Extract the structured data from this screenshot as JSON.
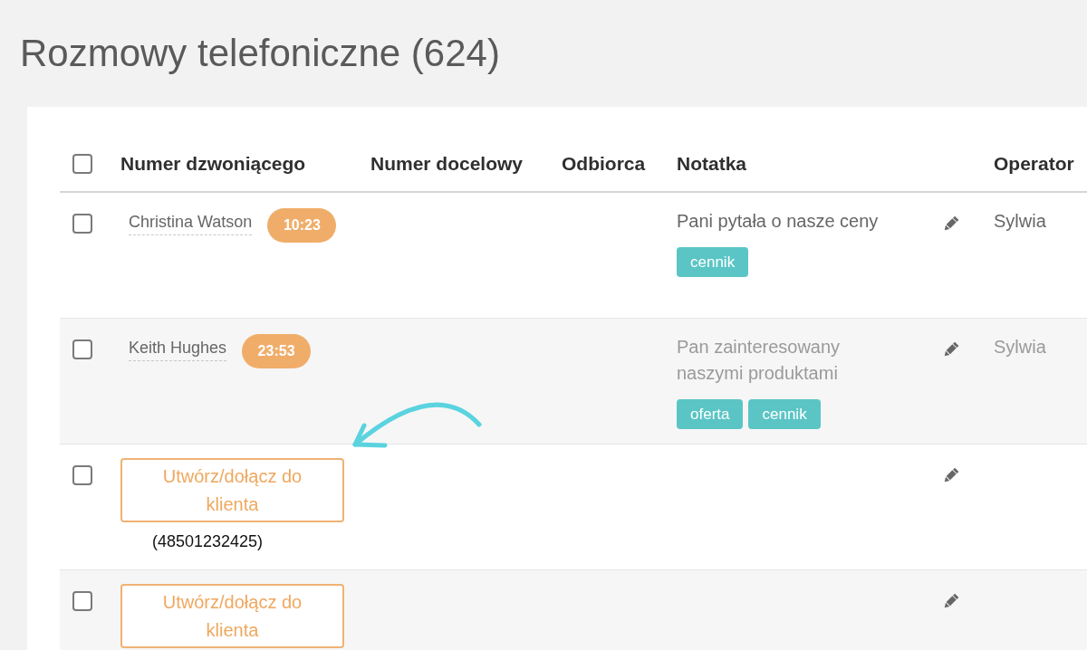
{
  "page": {
    "title": "Rozmowy telefoniczne (624)"
  },
  "table": {
    "header_checkbox": {
      "checked": false
    },
    "columns": [
      "Numer dzwoniącego",
      "Numer docelowy",
      "Odbiorca",
      "Notatka",
      "Operator"
    ],
    "rows": [
      {
        "checked": false,
        "caller": {
          "kind": "contact",
          "name": "Christina Watson",
          "duration": "10:23"
        },
        "note": "Pani pytała o nasze ceny",
        "dimmed": false,
        "tags": [
          "cennik"
        ],
        "operator": "Sylwia"
      },
      {
        "checked": false,
        "caller": {
          "kind": "contact",
          "name": "Keith Hughes",
          "duration": "23:53"
        },
        "note": "Pan zainteresowany naszymi produktami",
        "dimmed": true,
        "tags": [
          "oferta",
          "cennik"
        ],
        "operator": "Sylwia"
      },
      {
        "checked": false,
        "caller": {
          "kind": "unassigned",
          "action": "Utwórz/dołącz do klienta",
          "number": "(48501232425)"
        }
      },
      {
        "checked": false,
        "caller": {
          "kind": "unassigned",
          "action": "Utwórz/dołącz do klienta"
        }
      }
    ]
  }
}
